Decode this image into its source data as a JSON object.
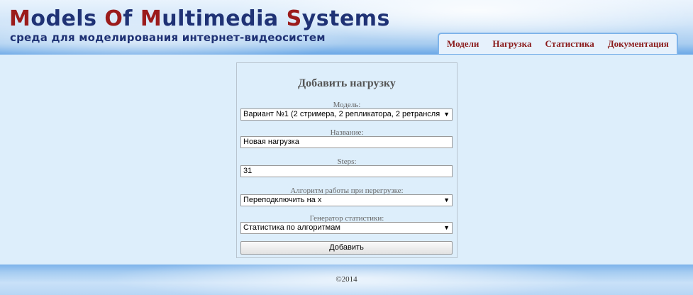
{
  "header": {
    "title_parts": [
      {
        "cap": "M",
        "rest": "odels "
      },
      {
        "cap": "O",
        "rest": "f "
      },
      {
        "cap": "M",
        "rest": "ultimedia "
      },
      {
        "cap": "S",
        "rest": "ystems"
      }
    ],
    "subtitle": "среда для моделирования интернет-видеосистем"
  },
  "nav": {
    "items": [
      "Модели",
      "Нагрузка",
      "Статистика",
      "Документация"
    ]
  },
  "form": {
    "title": "Добавить нагрузку",
    "model_label": "Модель:",
    "model_value": "Вариант №1 (2 стримера, 2 репликатора, 2 ретрансля",
    "name_label": "Название:",
    "name_value": "Новая нагрузка",
    "steps_label": "Steps:",
    "steps_value": "31",
    "algo_label": "Алгоритм работы при перегрузке:",
    "algo_value": "Переподключить на х",
    "generator_label": "Генератор статистики:",
    "generator_value": "Статистика по алгоритмам",
    "submit_label": "Добавить",
    "dropdown_arrow": "▼"
  },
  "footer": {
    "copyright": "©2014"
  },
  "colors": {
    "title_blue": "#1f3275",
    "title_red": "#9b1b1b",
    "nav_text": "#8a1a1a",
    "page_bg": "#ddeefb"
  }
}
